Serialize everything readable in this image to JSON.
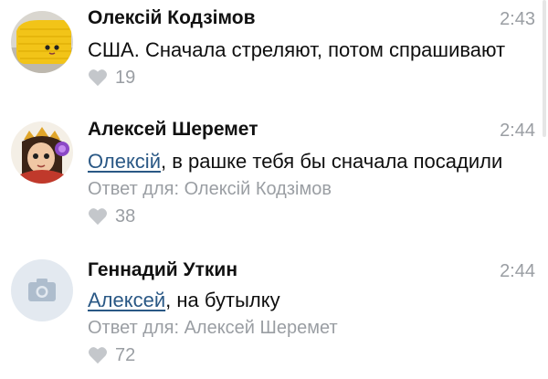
{
  "comments": [
    {
      "author": "Олексій Кодзімов",
      "time": "2:43",
      "text": "США. Сначала стреляют, потом спрашивают",
      "likes": "19",
      "avatar": "yellow-knit-toy"
    },
    {
      "author": "Алексей Шеремет",
      "time": "2:44",
      "mention": "Олексій",
      "text_rest": ", в рашке тебя бы сначала посадили",
      "reply_label": "Ответ для: Олексій Кодзімов",
      "likes": "38",
      "avatar": "cartoon-warrior"
    },
    {
      "author": "Геннадий Уткин",
      "time": "2:44",
      "mention": "Алексей",
      "text_rest": ", на бутылку",
      "reply_label": "Ответ для: Алексей Шеремет",
      "likes": "72",
      "avatar": "camera-placeholder"
    }
  ],
  "colors": {
    "link": "#2a5885",
    "meta": "#9a9ea3",
    "heart": "#c4c7cb",
    "placeholder_avatar": "#e3e9f0"
  }
}
